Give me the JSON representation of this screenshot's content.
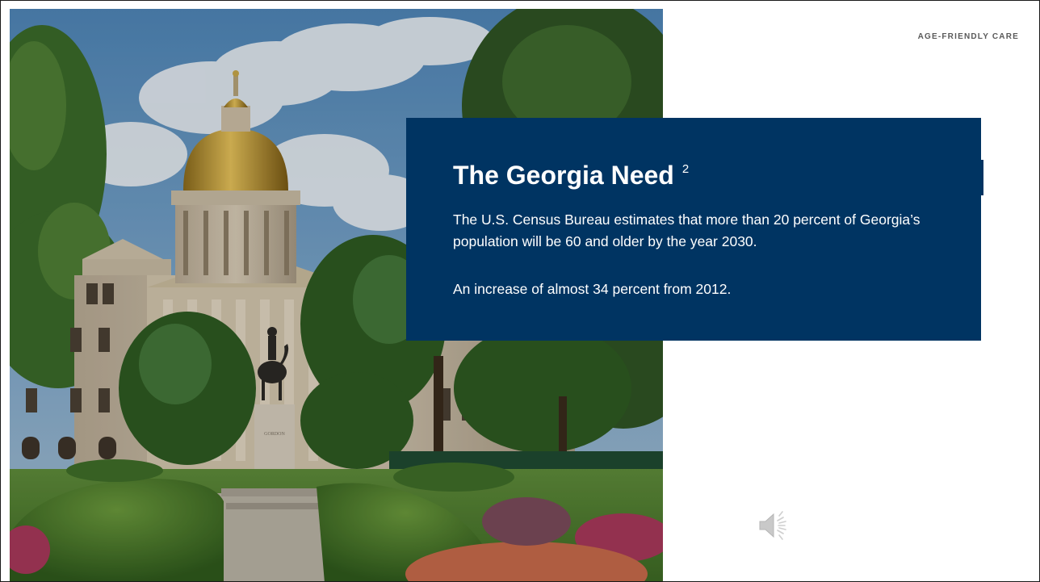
{
  "header": {
    "brand_label": "AGE-FRIENDLY CARE"
  },
  "photo": {
    "alt": "",
    "statue_plaque": "GORDON"
  },
  "panel": {
    "title": "The Georgia Need",
    "footnote": "2",
    "paragraph_1": "The U.S. Census Bureau estimates that more than 20 percent of Georgia’s population will be 60 and older by the year 2030.",
    "paragraph_2": "An increase of almost 34 percent from 2012."
  },
  "audio": {
    "icon": "speaker-icon"
  },
  "colors": {
    "panel_bg": "#003462",
    "brand_text": "#5a5a5a",
    "slide_bg": "#ffffff"
  }
}
